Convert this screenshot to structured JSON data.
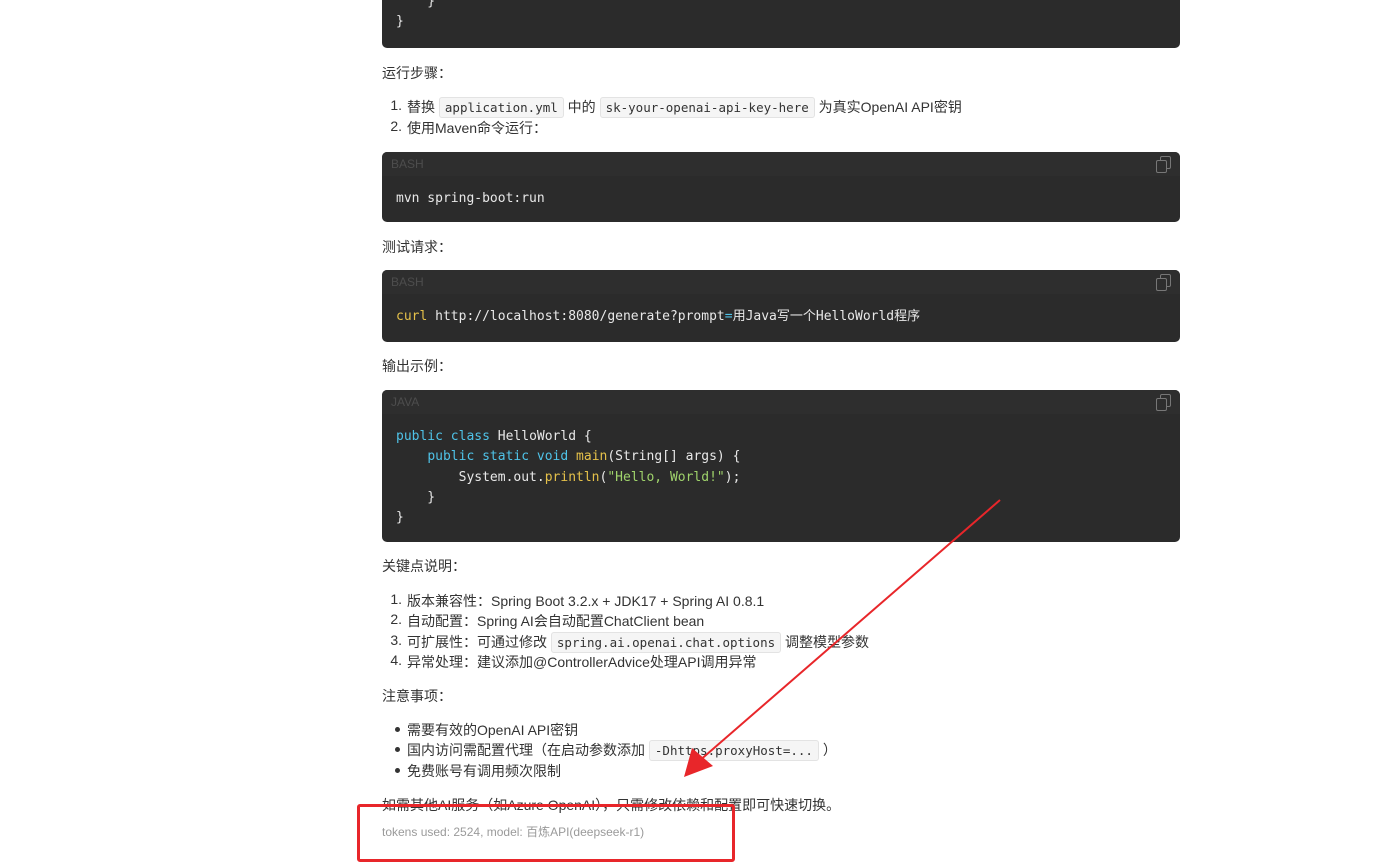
{
  "top_block": {
    "lines": [
      "    }",
      "}"
    ]
  },
  "section_run": "运行步骤：",
  "run_steps": [
    {
      "num": "1.",
      "pre": "替换",
      "code1": "application.yml",
      "mid": "中的",
      "code2": "sk-your-openai-api-key-here",
      "post": "为真实OpenAI API密钥"
    },
    {
      "num": "2.",
      "text": "使用Maven命令运行："
    }
  ],
  "block_bash1": {
    "lang": "BASH",
    "code": "mvn spring-boot:run"
  },
  "section_test": "测试请求：",
  "block_bash2": {
    "lang": "BASH",
    "cmd": "curl",
    "url": " http://localhost:8080/generate?prompt",
    "eq": "=",
    "rest": "用Java写一个HelloWorld程序"
  },
  "section_output": "输出示例：",
  "block_java": {
    "lang": "JAVA"
  },
  "section_keys": "关键点说明：",
  "key_points": [
    {
      "num": "1.",
      "text": "版本兼容性：Spring Boot 3.2.x + JDK17 + Spring AI 0.8.1"
    },
    {
      "num": "2.",
      "text": "自动配置：Spring AI会自动配置ChatClient bean"
    },
    {
      "num": "3.",
      "pre": "可扩展性：可通过修改",
      "code": "spring.ai.openai.chat.options",
      "post": "调整模型参数"
    },
    {
      "num": "4.",
      "text": "异常处理：建议添加@ControllerAdvice处理API调用异常"
    }
  ],
  "section_notes": "注意事项：",
  "notes": [
    {
      "text": "需要有效的OpenAI API密钥"
    },
    {
      "pre": "国内访问需配置代理（在启动参数添加",
      "code": "-Dhttps.proxyHost=...",
      "post": "）"
    },
    {
      "text": "免费账号有调用频次限制"
    }
  ],
  "closing": "如需其他AI服务（如Azure OpenAI），只需修改依赖和配置即可快速切换。",
  "meta": "tokens used: 2524, model: 百炼API(deepseek-r1)",
  "colors": {
    "annotation": "#e8262a",
    "code_bg": "#2b2b2b",
    "keyword": "#4fc3e8",
    "function": "#e5c14a",
    "string": "#9fd36b"
  }
}
